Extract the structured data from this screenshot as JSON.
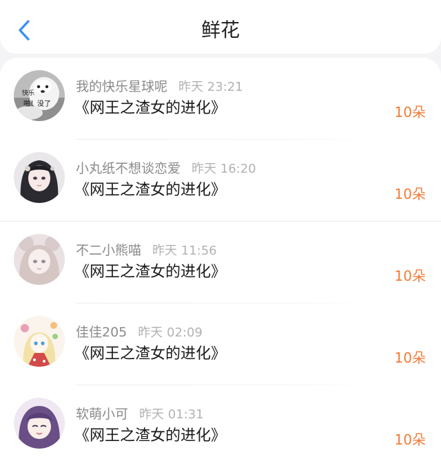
{
  "header": {
    "title": "鲜花",
    "back_icon": "chevron-left-icon",
    "accent_color": "#3b8ff5"
  },
  "gifts": [
    {
      "user": "我的快乐星球呢",
      "time": "昨天 23:21",
      "book": "《网王之渣女的进化》",
      "count": "10朵",
      "avatar_text_top": "快乐",
      "avatar_text_bottom": "啪！没了"
    },
    {
      "user": "小丸纸不想谈恋爱",
      "time": "昨天 16:20",
      "book": "《网王之渣女的进化》",
      "count": "10朵"
    },
    {
      "user": "不二小熊喵",
      "time": "昨天 11:56",
      "book": "《网王之渣女的进化》",
      "count": "10朵"
    },
    {
      "user": "佳佳205",
      "time": "昨天 02:09",
      "book": "《网王之渣女的进化》",
      "count": "10朵"
    },
    {
      "user": "软萌小可",
      "time": "昨天 01:31",
      "book": "《网王之渣女的进化》",
      "count": "10朵"
    }
  ],
  "colors": {
    "count": "#f47b38",
    "username": "#8a8a8a",
    "time": "#b2b2b2",
    "title": "#222222"
  }
}
